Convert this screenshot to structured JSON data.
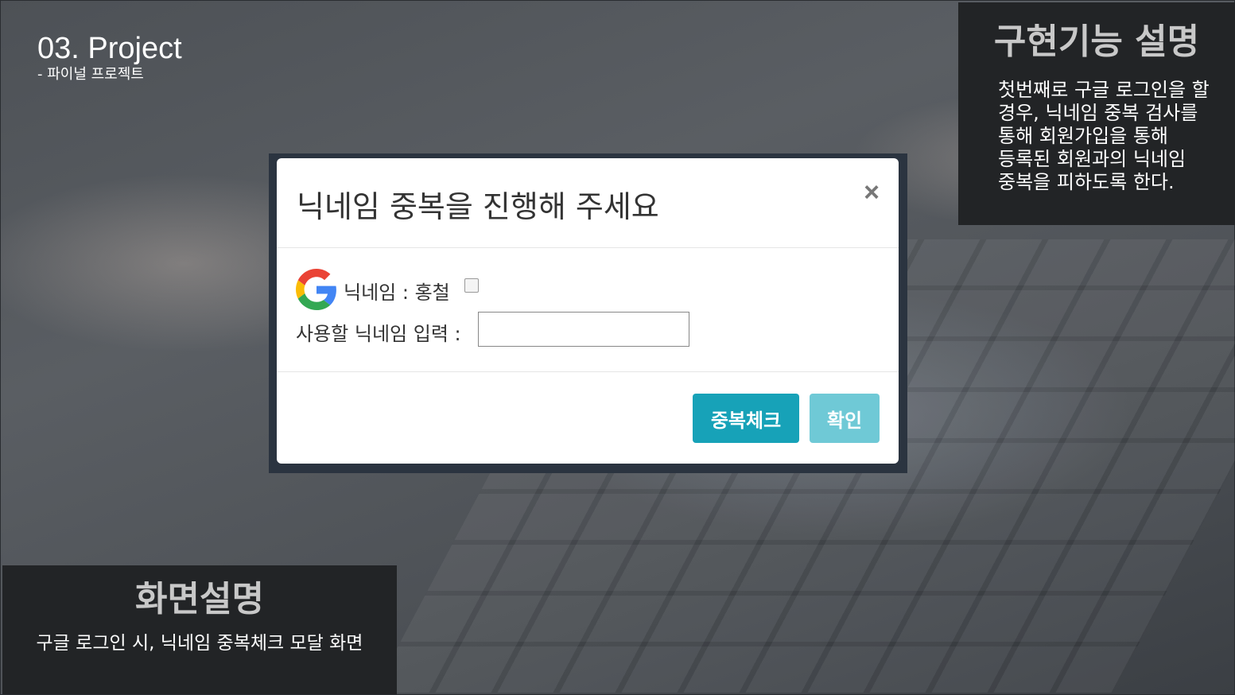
{
  "header": {
    "title": "03. Project",
    "subtitle": "- 파이널 프로젝트"
  },
  "feature_panel": {
    "heading": "구현기능 설명",
    "description": "첫번째로 구글 로그인을 할 경우, 닉네임 중복 검사를 통해 회원가입을 통해 등록된 회원과의 닉네임 중복을 피하도록 한다."
  },
  "screen_panel": {
    "heading": "화면설명",
    "description": "구글 로그인 시, 닉네임 중복체크 모달 화면"
  },
  "modal": {
    "title": "닉네임 중복을 진행해 주세요",
    "close_glyph": "×",
    "nickname_label": "닉네임 : 홍철",
    "input_label": "사용할 닉네임 입력 :",
    "input_value": "",
    "check_button": "중복체크",
    "confirm_button": "확인",
    "logo_icon": "google-g-icon"
  },
  "colors": {
    "primary_button": "#17a2b8",
    "disabled_button": "#6fc9d6",
    "panel_bg": "#222426"
  }
}
